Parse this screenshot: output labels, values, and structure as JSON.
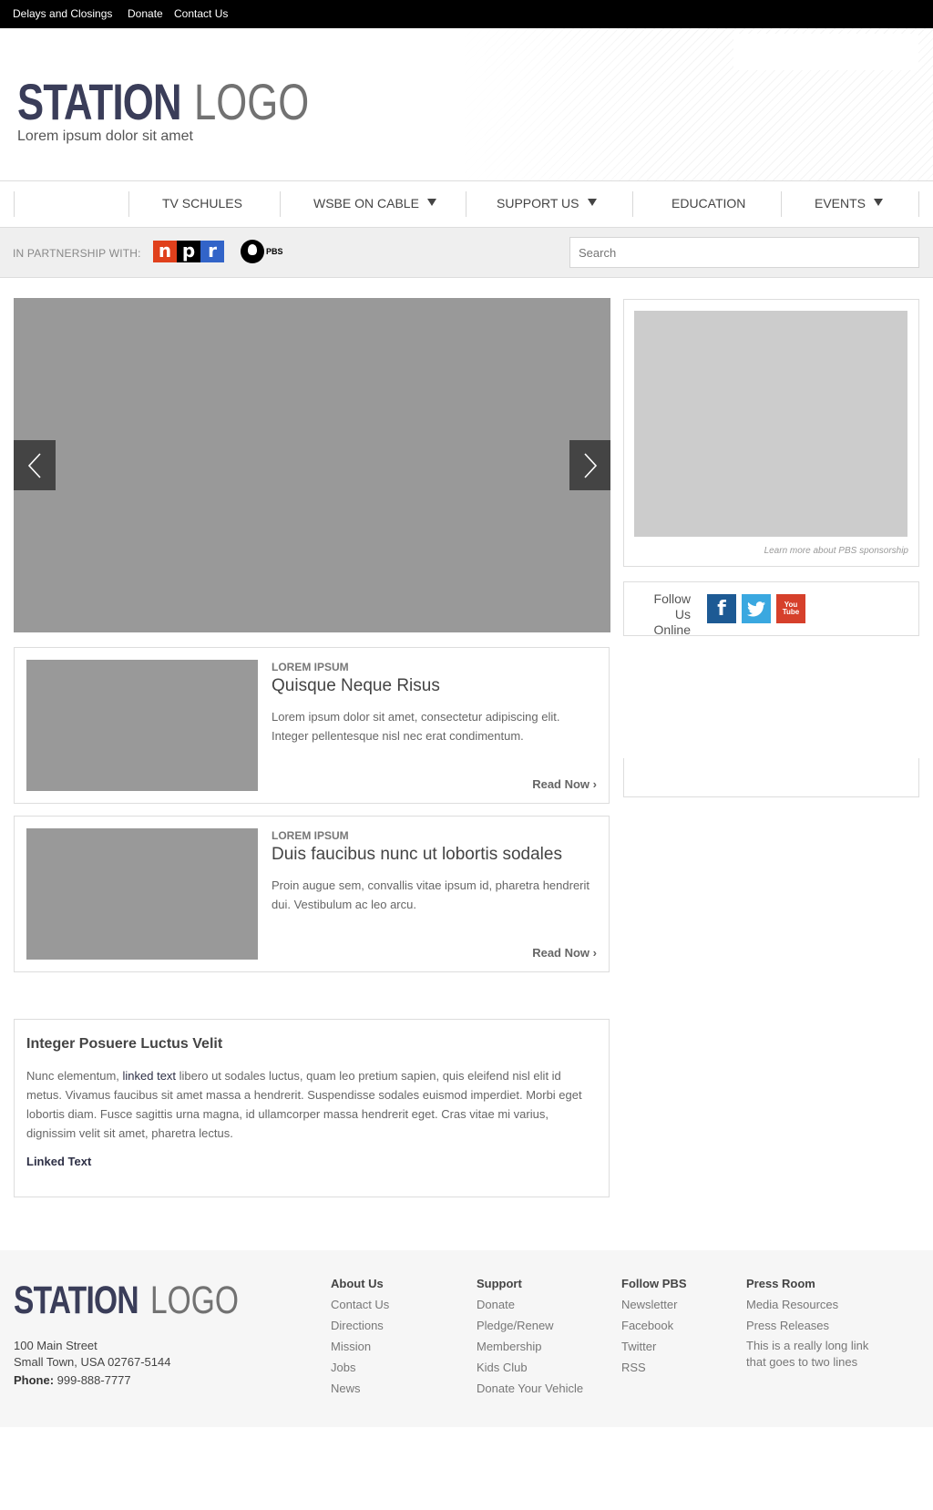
{
  "topbar": {
    "links": [
      "Delays and Closings",
      "Donate",
      "Contact Us"
    ]
  },
  "header": {
    "logo_bold": "STATION",
    "logo_thin": "LOGO",
    "tagline": "Lorem ipsum dolor sit amet"
  },
  "nav": {
    "items": [
      {
        "label": "TV SCHULES",
        "dropdown": false
      },
      {
        "label": "WSBE ON CABLE",
        "dropdown": true
      },
      {
        "label": "SUPPORT US",
        "dropdown": true
      },
      {
        "label": "EDUCATION",
        "dropdown": false
      },
      {
        "label": "EVENTS",
        "dropdown": true
      }
    ]
  },
  "partner": {
    "label": "IN PARTNERSHIP WITH:",
    "npr": [
      "n",
      "p",
      "r"
    ],
    "pbs": "PBS",
    "search_placeholder": "Search"
  },
  "sidebar": {
    "sponsor_caption": "Learn more about PBS sponsorship",
    "follow_label": "Follow Us Online",
    "social": [
      {
        "name": "facebook-icon",
        "glyph": "f",
        "color": "#1d5a94"
      },
      {
        "name": "twitter-icon",
        "color": "#3aa8e0"
      },
      {
        "name": "youtube-icon",
        "glyph": "You Tube",
        "color": "#d6402b"
      }
    ]
  },
  "articles": [
    {
      "kicker": "LOREM IPSUM",
      "title": "Quisque Neque Risus",
      "body": "Lorem ipsum dolor sit amet, consectetur adipiscing elit. Integer pellentesque nisl nec erat condimentum.",
      "read": "Read Now ›"
    },
    {
      "kicker": "LOREM IPSUM",
      "title": "Duis faucibus nunc ut lobortis sodales",
      "body": "Proin augue sem, convallis vitae ipsum id, pharetra hendrerit dui. Vestibulum ac leo arcu.",
      "read": "Read Now ›"
    }
  ],
  "textblock": {
    "heading": "Integer Posuere Luctus Velit",
    "p_before": "Nunc elementum, ",
    "p_link": "linked text",
    "p_after": " libero ut sodales luctus, quam leo pretium sapien, quis eleifend nisl elit id metus. Vivamus faucibus sit amet massa a hendrerit. Suspendisse sodales euismod imperdiet. Morbi eget lobortis diam. Fusce sagittis urna magna, id ullamcorper massa hendrerit eget. Cras vitae mi varius, dignissim velit sit amet, pharetra lectus.",
    "link": "Linked Text"
  },
  "footer": {
    "logo_bold": "STATION",
    "logo_thin": "LOGO",
    "address_line1": "100 Main Street",
    "address_line2": "Small Town, USA 02767-5144",
    "phone_label": "Phone:",
    "phone": " 999-888-7777",
    "columns": [
      {
        "heading": "About Us",
        "items": [
          "Contact Us",
          "Directions",
          "Mission",
          "Jobs",
          "News"
        ]
      },
      {
        "heading": "Support",
        "items": [
          "Donate",
          "Pledge/Renew",
          "Membership",
          "Kids Club",
          "Donate Your Vehicle"
        ]
      },
      {
        "heading": "Follow PBS",
        "items": [
          "Newsletter",
          "Facebook",
          "Twitter",
          "RSS"
        ]
      },
      {
        "heading": "Press Room",
        "items": [
          "Media Resources",
          "Press Releases",
          "This is a really long link that goes to two lines"
        ]
      }
    ]
  }
}
